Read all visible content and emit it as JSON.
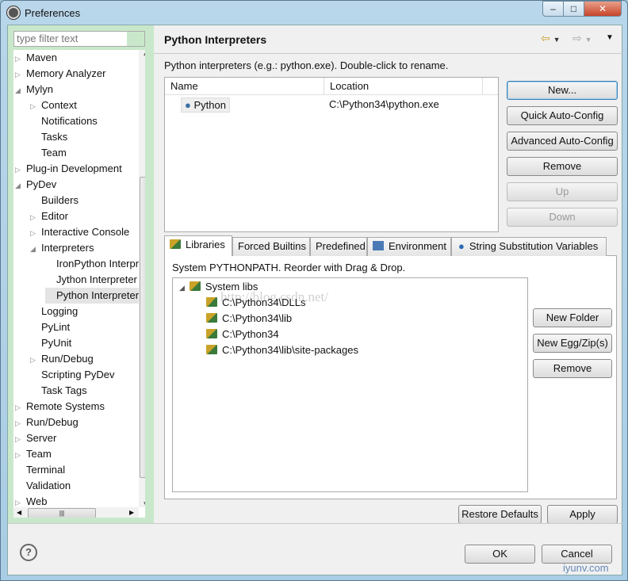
{
  "window": {
    "title": "Preferences",
    "controls": [
      "–",
      "□",
      "✕"
    ]
  },
  "sidebar": {
    "filter_placeholder": "type filter text",
    "items": [
      {
        "label": "Maven",
        "level": 0,
        "arrow": "closed"
      },
      {
        "label": "Memory Analyzer",
        "level": 0,
        "arrow": "closed"
      },
      {
        "label": "Mylyn",
        "level": 0,
        "arrow": "open"
      },
      {
        "label": "Context",
        "level": 1,
        "arrow": "closed"
      },
      {
        "label": "Notifications",
        "level": 1,
        "arrow": ""
      },
      {
        "label": "Tasks",
        "level": 1,
        "arrow": ""
      },
      {
        "label": "Team",
        "level": 1,
        "arrow": ""
      },
      {
        "label": "Plug-in Development",
        "level": 0,
        "arrow": "closed"
      },
      {
        "label": "PyDev",
        "level": 0,
        "arrow": "open"
      },
      {
        "label": "Builders",
        "level": 1,
        "arrow": ""
      },
      {
        "label": "Editor",
        "level": 1,
        "arrow": "closed"
      },
      {
        "label": "Interactive Console",
        "level": 1,
        "arrow": "closed"
      },
      {
        "label": "Interpreters",
        "level": 1,
        "arrow": "open"
      },
      {
        "label": "IronPython Interpreter",
        "level": 2,
        "arrow": ""
      },
      {
        "label": "Jython Interpreter",
        "level": 2,
        "arrow": ""
      },
      {
        "label": "Python Interpreter",
        "level": 2,
        "arrow": "",
        "selected": true
      },
      {
        "label": "Logging",
        "level": 1,
        "arrow": ""
      },
      {
        "label": "PyLint",
        "level": 1,
        "arrow": ""
      },
      {
        "label": "PyUnit",
        "level": 1,
        "arrow": ""
      },
      {
        "label": "Run/Debug",
        "level": 1,
        "arrow": "closed"
      },
      {
        "label": "Scripting PyDev",
        "level": 1,
        "arrow": ""
      },
      {
        "label": "Task Tags",
        "level": 1,
        "arrow": ""
      },
      {
        "label": "Remote Systems",
        "level": 0,
        "arrow": "closed"
      },
      {
        "label": "Run/Debug",
        "level": 0,
        "arrow": "closed"
      },
      {
        "label": "Server",
        "level": 0,
        "arrow": "closed"
      },
      {
        "label": "Team",
        "level": 0,
        "arrow": "closed"
      },
      {
        "label": "Terminal",
        "level": 0,
        "arrow": ""
      },
      {
        "label": "Validation",
        "level": 0,
        "arrow": ""
      },
      {
        "label": "Web",
        "level": 0,
        "arrow": "closed"
      }
    ]
  },
  "page": {
    "title": "Python Interpreters",
    "description": "Python interpreters (e.g.: python.exe).   Double-click to rename.",
    "columns": [
      "Name",
      "Location"
    ],
    "interpreters": [
      {
        "name": "Python",
        "location": "C:\\Python34\\python.exe"
      }
    ],
    "buttons": [
      "New...",
      "Quick Auto-Config",
      "Advanced Auto-Config",
      "Remove",
      "Up",
      "Down"
    ],
    "tabs": [
      "Libraries",
      "Forced Builtins",
      "Predefined",
      "Environment",
      "String Substitution Variables"
    ],
    "libraries_desc": "System PYTHONPATH.   Reorder with Drag & Drop.",
    "root": "System libs",
    "paths": [
      "C:\\Python34\\DLLs",
      "C:\\Python34\\lib",
      "C:\\Python34",
      "C:\\Python34\\lib\\site-packages"
    ],
    "lib_buttons": [
      "New Folder",
      "New Egg/Zip(s)",
      "Remove"
    ],
    "restore_defaults": "Restore Defaults",
    "apply": "Apply"
  },
  "footer": {
    "ok": "OK",
    "cancel": "Cancel",
    "help": "?"
  },
  "watermarks": [
    "http://blog.csdn.net/",
    "iyunv.com"
  ]
}
